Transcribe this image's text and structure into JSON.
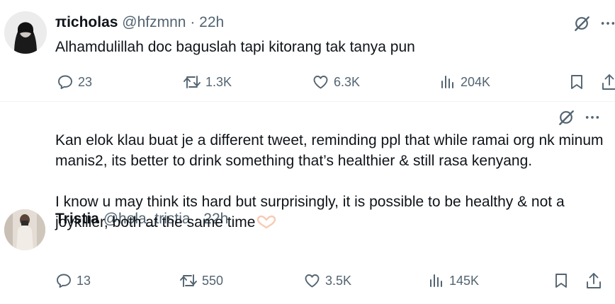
{
  "tweets": [
    {
      "display_name": "πicholas",
      "handle": "@hfzmnn",
      "separator": "·",
      "time": "22h",
      "text": "Alhamdulillah doc baguslah tapi kitorang tak tanya pun",
      "replies": "23",
      "reposts": "1.3K",
      "likes": "6.3K",
      "views": "204K"
    },
    {
      "display_name": "Tristia",
      "handle": "@hola_tristia",
      "separator": "·",
      "time": "22h",
      "paragraph1": "Kan elok klau buat je a different tweet, reminding ppl that while ramai org nk minum manis2, its better to drink something that’s healthier & still rasa kenyang.",
      "paragraph2": "I know u may think its hard but surprisingly, it is possible to be healthy & not a joykiller, both at the same time",
      "replies": "13",
      "reposts": "550",
      "likes": "3.5K",
      "views": "145K"
    }
  ],
  "icons": {
    "grok": "grok-slash-icon",
    "more": "more-dots-icon",
    "reply": "reply-bubble-icon",
    "repost": "repost-arrows-icon",
    "like": "heart-icon",
    "views": "views-bars-icon",
    "bookmark": "bookmark-icon",
    "share": "share-upload-icon",
    "emoji": "heart-hands-emoji"
  },
  "colors": {
    "text": "#0f1419",
    "secondary": "#536471",
    "divider": "#eff3f4"
  }
}
